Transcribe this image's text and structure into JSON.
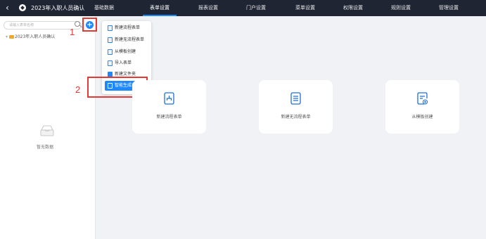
{
  "header": {
    "back_icon": "chevron-left-icon",
    "app_icon": "app-logo-icon",
    "title": "2023年入职人员确认",
    "tabs": [
      {
        "label": "基础数据",
        "active": false
      },
      {
        "label": "表单设置",
        "active": true
      },
      {
        "label": "报表设置",
        "active": false
      },
      {
        "label": "门户设置",
        "active": false
      },
      {
        "label": "菜单设置",
        "active": false
      },
      {
        "label": "权限设置",
        "active": false
      },
      {
        "label": "规则设置",
        "active": false
      },
      {
        "label": "管理设置",
        "active": false
      }
    ]
  },
  "sidebar": {
    "search_placeholder": "请输入表单名称",
    "tree_root": "2023年入职人员确认",
    "empty_text": "暂无数据",
    "add_icon": "plus-circle-icon"
  },
  "dropdown": {
    "items": [
      {
        "label": "新建流程表单",
        "icon": "flow-form-icon"
      },
      {
        "label": "新建无流程表单",
        "icon": "form-icon"
      },
      {
        "label": "从模板创建",
        "icon": "template-icon"
      },
      {
        "label": "导入表单",
        "icon": "import-icon"
      },
      {
        "label": "新建文件夹",
        "icon": "folder-icon"
      },
      {
        "label": "智能生成表单",
        "icon": "ai-form-icon",
        "active": true
      }
    ]
  },
  "cards": [
    {
      "label": "新建流程表单",
      "icon": "flow-form-icon"
    },
    {
      "label": "新建无流程表单",
      "icon": "form-icon"
    },
    {
      "label": "从模板创建",
      "icon": "template-add-icon"
    }
  ],
  "annotations": {
    "step1": "1",
    "step2": "2"
  },
  "colors": {
    "nav_bg": "#1f2533",
    "accent": "#1e88ff",
    "annotation_red": "#e53935"
  }
}
